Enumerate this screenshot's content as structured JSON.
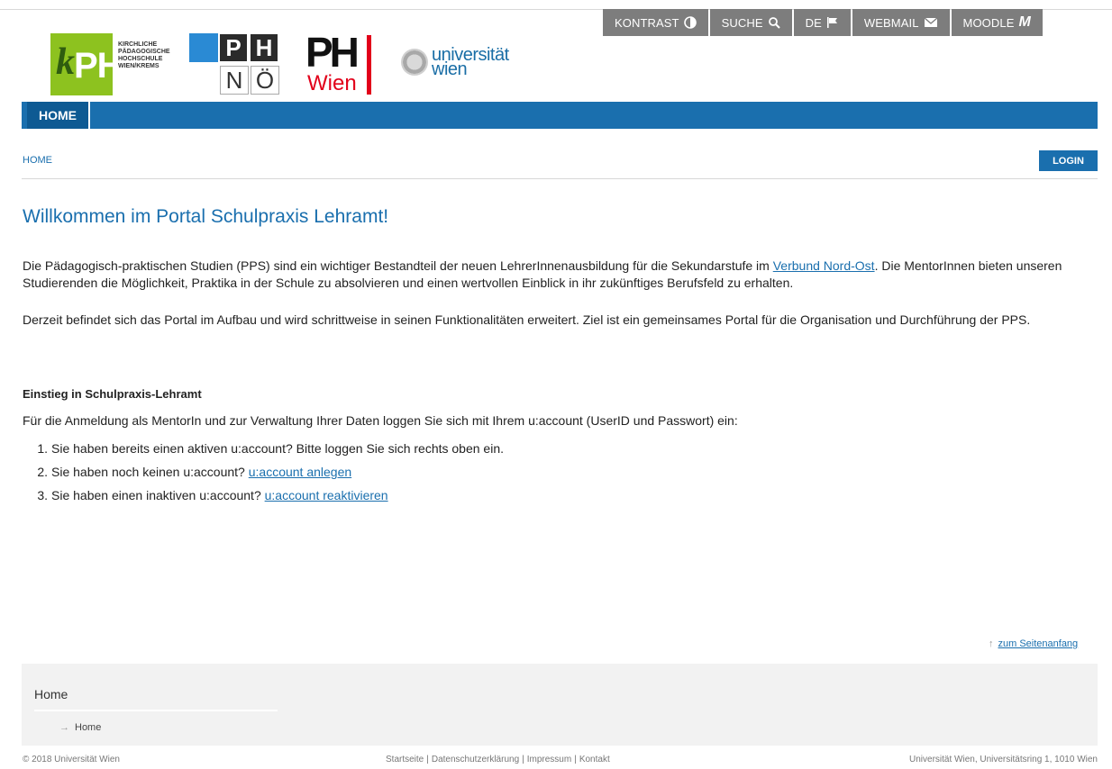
{
  "utility_bar": [
    {
      "label": "KONTRAST",
      "icon": "contrast-icon"
    },
    {
      "label": "SUCHE",
      "icon": "search-icon"
    },
    {
      "label": "DE",
      "icon": "flag-icon"
    },
    {
      "label": "WEBMAIL",
      "icon": "envelope-icon"
    },
    {
      "label": "MOODLE",
      "icon": "moodle-icon"
    }
  ],
  "logos": {
    "kph": {
      "mark_k": "k",
      "mark_ph": "PH",
      "text": [
        "KIRCHLICHE",
        "PÄDAGOGISCHE",
        "HOCHSCHULE",
        "WIEN/KREMS"
      ]
    },
    "phnoe": {
      "p": "P",
      "h": "H",
      "n": "N",
      "oe": "Ö"
    },
    "phwien": {
      "ph": "PH",
      "wien": "Wien"
    },
    "univie": {
      "line1": "universität",
      "line2": "wien"
    }
  },
  "nav": {
    "home": "HOME"
  },
  "breadcrumb": "HOME",
  "login": "LOGIN",
  "content": {
    "title": "Willkommen im Portal Schulpraxis Lehramt!",
    "p1_before": "Die Pädagogisch-praktischen Studien (PPS) sind ein wichtiger Bestandteil der neuen LehrerInnenausbildung für die Sekundarstufe im ",
    "p1_link": "Verbund Nord-Ost",
    "p1_after": ". Die MentorInnen bieten unseren Studierenden die Möglichkeit, Praktika in der Schule zu absolvieren und einen wertvollen Einblick in ihr zukünftiges Berufsfeld zu erhalten.",
    "p2": "Derzeit befindet sich das Portal im Aufbau und wird schrittweise in seinen Funktionalitäten erweitert. Ziel ist ein gemeinsames Portal für die Organisation und Durchführung der PPS.",
    "subtitle": "Einstieg in Schulpraxis-Lehramt",
    "intro": "Für die Anmeldung als MentorIn und zur Verwaltung Ihrer Daten loggen Sie sich mit Ihrem u:account (UserID und Passwort) ein:",
    "steps": [
      {
        "num": "1.",
        "text": "Sie haben bereits einen aktiven u:account? Bitte loggen Sie sich rechts oben ein.",
        "link": ""
      },
      {
        "num": "2.",
        "text": "Sie haben noch keinen u:account? ",
        "link": "u:account anlegen"
      },
      {
        "num": "3.",
        "text": "Sie haben einen inaktiven u:account? ",
        "link": "u:account reaktivieren"
      }
    ]
  },
  "to_top": {
    "arrow": "↑",
    "label": "zum Seitenanfang"
  },
  "footer": {
    "title": "Home",
    "link_arrow": "→",
    "link": "Home",
    "copyright": "© 2018 Universität Wien",
    "links": [
      "Startseite",
      "Datenschutzerklärung",
      "Impressum",
      "Kontakt"
    ],
    "separator": "|",
    "address": "Universität Wien, Universitätsring 1, 1010 Wien"
  },
  "colors": {
    "brand_blue": "#1a6fae",
    "util_grey": "#7d7d7d",
    "kph_green": "#8dc21f",
    "phwien_red": "#e2001a"
  }
}
